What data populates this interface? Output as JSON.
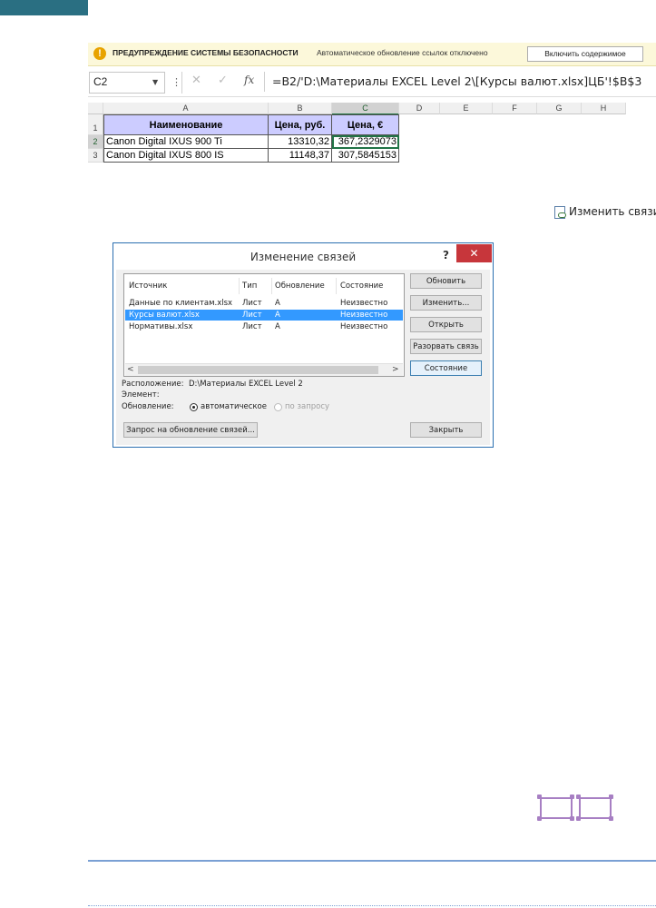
{
  "security_bar": {
    "title": "ПРЕДУПРЕЖДЕНИЕ СИСТЕМЫ БЕЗОПАСНОСТИ",
    "message": "Автоматическое обновление ссылок отключено",
    "enable_button": "Включить содержимое",
    "icon": "exclamation-icon"
  },
  "formula_bar": {
    "name_box": "C2",
    "formula": "=B2/'D:\\Материалы EXCEL Level 2\\[Курсы валют.xlsx]ЦБ'!$B$3",
    "fx_label": "fx"
  },
  "sheet": {
    "columns": [
      "A",
      "B",
      "C",
      "D",
      "E",
      "F",
      "G",
      "H"
    ],
    "rows": [
      "1",
      "2",
      "3"
    ],
    "header": [
      "Наименование",
      "Цена, руб.",
      "Цена, €"
    ],
    "data": [
      [
        "Canon Digital IXUS 900 Ti",
        "13310,32",
        "367,2329073"
      ],
      [
        "Canon Digital IXUS 800 IS",
        "11148,37",
        "307,5845153"
      ]
    ]
  },
  "edit_links_command": "Изменить связи",
  "dialog": {
    "title": "Изменение связей",
    "help": "?",
    "close": "✕",
    "list_headers": [
      "Источник",
      "Тип",
      "Обновление",
      "Состояние"
    ],
    "list_rows": [
      [
        "Данные по клиентам.xlsx",
        "Лист",
        "А",
        "Неизвестно"
      ],
      [
        "Курсы валют.xlsx",
        "Лист",
        "А",
        "Неизвестно"
      ],
      [
        "Нормативы.xlsx",
        "Лист",
        "А",
        "Неизвестно"
      ]
    ],
    "selected_row": 1,
    "buttons": {
      "update": "Обновить",
      "change": "Изменить...",
      "open": "Открыть",
      "break": "Разорвать связь",
      "status": "Состояние",
      "close": "Закрыть",
      "startup_prompt": "Запрос на обновление связей..."
    },
    "location_label": "Расположение:",
    "location_value": "D:\\Материалы EXCEL Level 2",
    "element_label": "Элемент:",
    "update_label": "Обновление:",
    "radio_auto": "автоматическое",
    "radio_manual": "по запросу"
  }
}
